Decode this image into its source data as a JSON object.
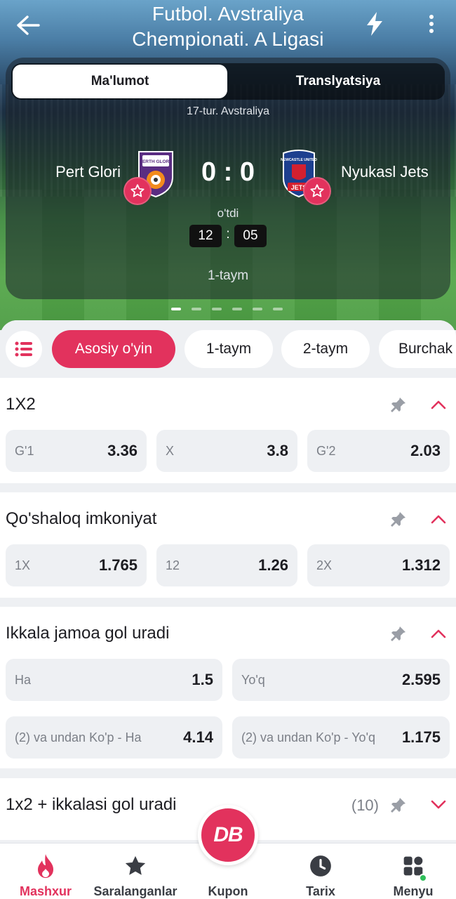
{
  "header": {
    "title_line1": "Futbol. Avstraliya",
    "title_line2": "Chempionati. A Ligasi"
  },
  "match_tabs": [
    {
      "label": "Ma'lumot",
      "active": true
    },
    {
      "label": "Translyatsiya",
      "active": false
    }
  ],
  "match": {
    "round": "17-tur. Avstraliya",
    "home_team": "Pert Glori",
    "away_team": "Nyukasl Jets",
    "home_logo_text": "PERTH GLORY",
    "away_logo_text_top": "NEWCASTLE UNITED",
    "away_logo_text": "JETS",
    "score": "0 : 0",
    "status": "o'tdi",
    "timer_min": "12",
    "timer_sep": ":",
    "timer_sec": "05",
    "period": "1-taym"
  },
  "carousel": {
    "count": 6,
    "active_index": 0
  },
  "filters": [
    {
      "label": "Asosiy o'yin",
      "active": true
    },
    {
      "label": "1-taym",
      "active": false
    },
    {
      "label": "2-taym",
      "active": false
    },
    {
      "label": "Burchak",
      "active": false
    }
  ],
  "sections": [
    {
      "title": "1X2",
      "expanded": true,
      "odds": [
        {
          "label": "G'1",
          "value": "3.36"
        },
        {
          "label": "X",
          "value": "3.8"
        },
        {
          "label": "G'2",
          "value": "2.03"
        }
      ]
    },
    {
      "title": "Qo'shaloq imkoniyat",
      "expanded": true,
      "odds": [
        {
          "label": "1X",
          "value": "1.765"
        },
        {
          "label": "12",
          "value": "1.26"
        },
        {
          "label": "2X",
          "value": "1.312"
        }
      ]
    },
    {
      "title": "Ikkala jamoa gol uradi",
      "expanded": true,
      "odds": [
        {
          "label": "Ha",
          "value": "1.5"
        },
        {
          "label": "Yo'q",
          "value": "2.595"
        },
        {
          "label": "(2) va undan Ko'p - Ha",
          "value": "4.14"
        },
        {
          "label": "(2) va undan Ko'p - Yo'q",
          "value": "1.175"
        }
      ]
    },
    {
      "title": "1x2 + ikkalasi gol uradi",
      "count": "(10)",
      "expanded": false
    }
  ],
  "bottom_nav": [
    {
      "label": "Mashxur",
      "icon": "flame-icon",
      "active": true
    },
    {
      "label": "Saralanganlar",
      "icon": "star-icon",
      "active": false
    },
    {
      "label": "Kupon",
      "icon": "coupon-icon",
      "active": false
    },
    {
      "label": "Tarix",
      "icon": "clock-icon",
      "active": false
    },
    {
      "label": "Menyu",
      "icon": "grid-icon",
      "active": false
    }
  ],
  "coupon_logo": "DB",
  "colors": {
    "accent": "#e2325d",
    "background": "#eef0f3",
    "odd_tile": "#eef0f3",
    "online_dot": "#2fbf5a"
  }
}
